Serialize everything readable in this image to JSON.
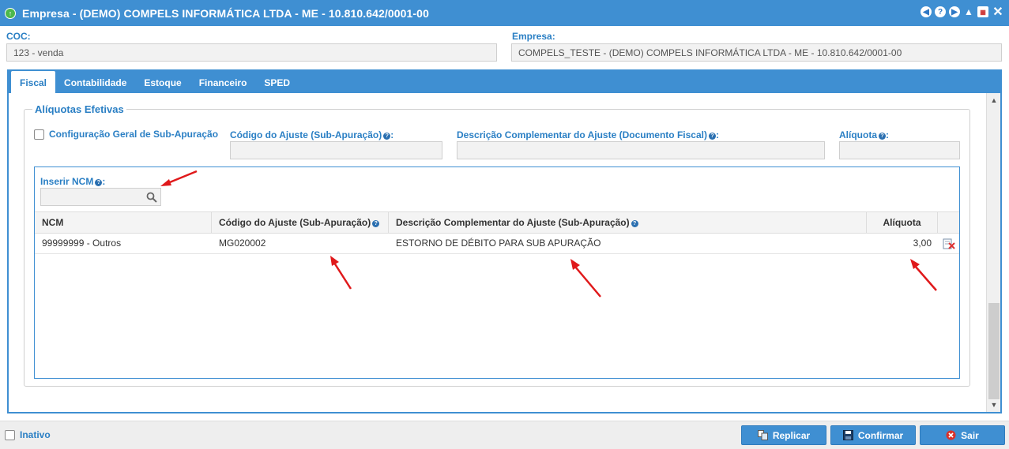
{
  "window": {
    "title": "Empresa - (DEMO) COMPELS INFORMÁTICA LTDA - ME - 10.810.642/0001-00",
    "close_glyph": "✕"
  },
  "header": {
    "coc_label": "COC:",
    "coc_value": "123 - venda",
    "empresa_label": "Empresa:",
    "empresa_value": "COMPELS_TESTE - (DEMO) COMPELS INFORMÁTICA LTDA - ME - 10.810.642/0001-00"
  },
  "tabs": [
    {
      "label": "Fiscal",
      "active": true
    },
    {
      "label": "Contabilidade",
      "active": false
    },
    {
      "label": "Estoque",
      "active": false
    },
    {
      "label": "Financeiro",
      "active": false
    },
    {
      "label": "SPED",
      "active": false
    }
  ],
  "aliquotas": {
    "legend": "Alíquotas Efetivas",
    "config_geral_label": "Configuração Geral de Sub-Apuração",
    "codigo_ajuste_label": "Código do Ajuste (Sub-Apuração)",
    "descricao_complementar_label": "Descrição Complementar do Ajuste (Documento Fiscal)",
    "aliquota_label": "Alíquota",
    "label_suffix": ":",
    "inserir_ncm_label": "Inserir NCM",
    "grid": {
      "columns": [
        "NCM",
        "Código do Ajuste (Sub-Apuração)",
        "Descrição Complementar do Ajuste (Sub-Apuração)",
        "Alíquota"
      ],
      "rows": [
        {
          "ncm": "99999999 - Outros",
          "codigo": "MG020002",
          "descricao": "ESTORNO DE DÉBITO PARA SUB APURAÇÃO",
          "aliquota": "3,00"
        }
      ]
    }
  },
  "footer": {
    "inativo_label": "Inativo",
    "replicar_label": "Replicar",
    "confirmar_label": "Confirmar",
    "sair_label": "Sair"
  },
  "colors": {
    "accent": "#3f8fd2",
    "label_blue": "#2a7fc4",
    "annotation_red": "#e0191b"
  },
  "icons": [
    "app-icon",
    "arrow-left-icon",
    "help-icon",
    "play-icon",
    "bell-icon",
    "calendar-icon",
    "close-icon",
    "search-icon",
    "delete-row-icon",
    "replicate-icon",
    "save-icon",
    "exit-icon"
  ]
}
